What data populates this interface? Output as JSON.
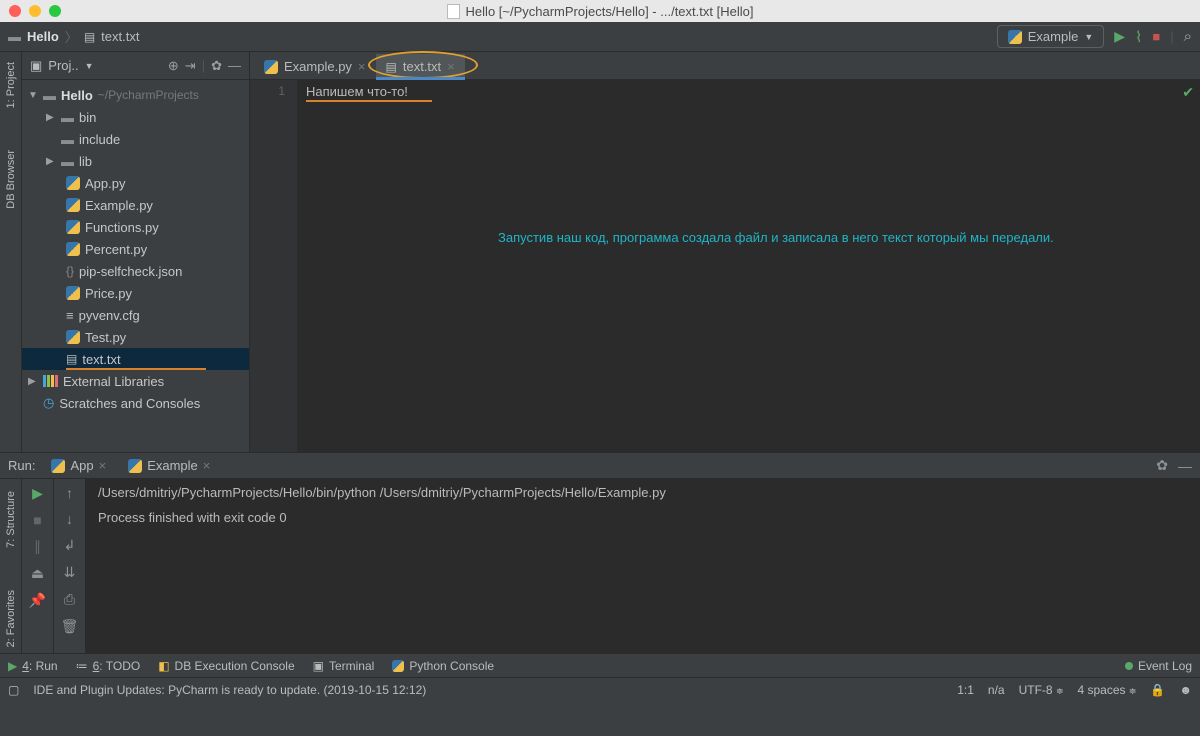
{
  "title": "Hello [~/PycharmProjects/Hello] - .../text.txt [Hello]",
  "breadcrumb": {
    "root": "Hello",
    "file": "text.txt"
  },
  "run_config": {
    "label": "Example"
  },
  "left_rail": {
    "project": "1: Project",
    "db": "DB Browser"
  },
  "left_rail_bottom": {
    "structure": "7: Structure",
    "favorites": "2: Favorites"
  },
  "project_panel": {
    "title": "Proj..",
    "root": {
      "name": "Hello",
      "path": "~/PycharmProjects"
    },
    "folders": [
      "bin",
      "include",
      "lib"
    ],
    "files": [
      "App.py",
      "Example.py",
      "Functions.py",
      "Percent.py",
      "pip-selfcheck.json",
      "Price.py",
      "pyvenv.cfg",
      "Test.py",
      "text.txt"
    ],
    "ext_lib": "External Libraries",
    "scratches": "Scratches and Consoles"
  },
  "editor": {
    "tabs": [
      {
        "name": "Example.py",
        "active": false
      },
      {
        "name": "text.txt",
        "active": true
      }
    ],
    "line_number": "1",
    "content_line": "Напишем что-то!",
    "caption": "Запустив наш код, программа создала файл и записала в него текст который мы передали."
  },
  "run": {
    "label": "Run:",
    "tabs": [
      {
        "name": "App"
      },
      {
        "name": "Example"
      }
    ],
    "output_cmd": "/Users/dmitriy/PycharmProjects/Hello/bin/python /Users/dmitriy/PycharmProjects/Hello/Example.py",
    "output_exit": "Process finished with exit code 0"
  },
  "bottom_toolbar": {
    "run": "4: Run",
    "todo": "6: TODO",
    "db": "DB Execution Console",
    "terminal": "Terminal",
    "pyconsole": "Python Console",
    "eventlog": "Event Log"
  },
  "status": {
    "msg": "IDE and Plugin Updates: PyCharm is ready to update. (2019-10-15 12:12)",
    "pos": "1:1",
    "na": "n/a",
    "encoding": "UTF-8",
    "indent": "4 spaces"
  }
}
